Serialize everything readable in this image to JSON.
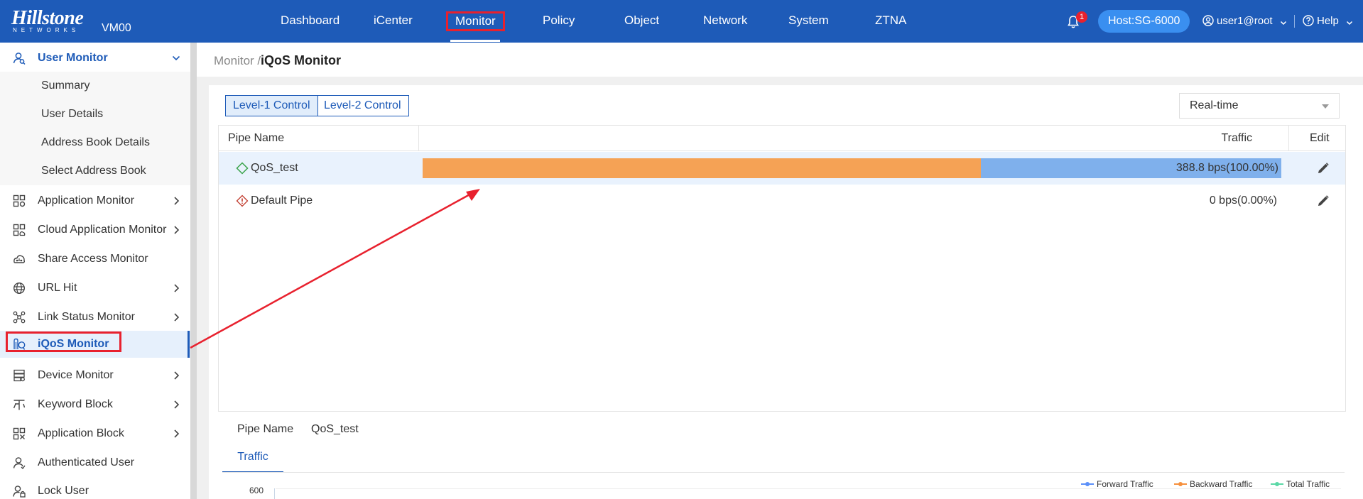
{
  "brand": {
    "logo": "Hillstone",
    "logo_sub": "NETWORKS",
    "device": "VM00"
  },
  "topnav": {
    "items": [
      "Dashboard",
      "iCenter",
      "Monitor",
      "Policy",
      "Object",
      "Network",
      "System",
      "ZTNA"
    ],
    "notifications": "1",
    "host": "Host:SG-6000",
    "user": "user1@root",
    "help": "Help"
  },
  "sidebar": {
    "group_title": "User Monitor",
    "sub_items": [
      "Summary",
      "User Details",
      "Address Book Details",
      "Select Address Book"
    ],
    "items": [
      "Application Monitor",
      "Cloud Application Monitor",
      "Share Access Monitor",
      "URL Hit",
      "Link Status Monitor",
      "iQoS Monitor",
      "Device Monitor",
      "Keyword Block",
      "Application Block",
      "Authenticated User",
      "Lock User"
    ],
    "active": "iQoS Monitor"
  },
  "breadcrumb": {
    "parent": "Monitor /",
    "current": "iQoS Monitor"
  },
  "controls": {
    "level1": "Level-1 Control",
    "level2": "Level-2 Control",
    "period": "Real-time"
  },
  "table": {
    "headers": {
      "pipe_name": "Pipe Name",
      "traffic": "Traffic",
      "edit": "Edit"
    },
    "rows": [
      {
        "name": "QoS_test",
        "traffic": "388.8 bps(100.00%)",
        "forward_fraction": 0.65,
        "total_fraction": 1.0
      },
      {
        "name": "Default Pipe",
        "traffic": "0 bps(0.00%)"
      }
    ]
  },
  "detail": {
    "pipe_name_label": "Pipe Name",
    "pipe_name_value": "QoS_test",
    "tab": "Traffic"
  },
  "chart_data": {
    "type": "line",
    "y_ticks": [
      "600"
    ],
    "series": [
      {
        "name": "Forward Traffic",
        "color": "#5b8ff9"
      },
      {
        "name": "Backward Traffic",
        "color": "#f6903d"
      },
      {
        "name": "Total Traffic",
        "color": "#5ad8a6"
      }
    ],
    "legend_position": "top-right"
  },
  "colors": {
    "accent": "#1e5bb8",
    "forward_bar": "#f5a255",
    "backward_bar": "#7fb0ec",
    "annotation": "#e8212e"
  }
}
